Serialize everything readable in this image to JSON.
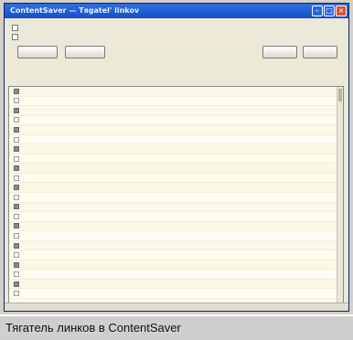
{
  "window": {
    "title": "ContentSaver — Tяgatel' linkov",
    "title_buttons": [
      "minimize-icon",
      "maximize-icon",
      "close-icon"
    ]
  },
  "description": "",
  "options": [
    {
      "label": "",
      "checked": false
    },
    {
      "label": "",
      "checked": false
    }
  ],
  "buttons": {
    "select_all": "",
    "clear_all": "",
    "ok": "",
    "cancel": ""
  },
  "links": [
    {
      "type": "folder",
      "text": ""
    },
    {
      "type": "link",
      "text": ""
    },
    {
      "type": "folder",
      "text": ""
    },
    {
      "type": "link",
      "text": ""
    },
    {
      "type": "folder",
      "text": ""
    },
    {
      "type": "link",
      "text": ""
    },
    {
      "type": "folder",
      "text": ""
    },
    {
      "type": "link",
      "text": ""
    },
    {
      "type": "folder",
      "text": ""
    },
    {
      "type": "link",
      "text": ""
    },
    {
      "type": "folder",
      "text": ""
    },
    {
      "type": "link",
      "text": ""
    },
    {
      "type": "folder",
      "text": ""
    },
    {
      "type": "link",
      "text": ""
    },
    {
      "type": "folder",
      "text": ""
    },
    {
      "type": "link",
      "text": ""
    },
    {
      "type": "folder",
      "text": ""
    },
    {
      "type": "link",
      "text": ""
    },
    {
      "type": "folder",
      "text": ""
    },
    {
      "type": "link",
      "text": ""
    },
    {
      "type": "folder",
      "text": ""
    },
    {
      "type": "link",
      "text": ""
    }
  ],
  "statusbar": "",
  "caption": "Тягатель линков в ContentSaver",
  "colors": {
    "titlebar": "#1f5fd8",
    "link": "#2d5fd6",
    "list_background": "#fffdf0",
    "caption_background": "#cfcfcf"
  }
}
